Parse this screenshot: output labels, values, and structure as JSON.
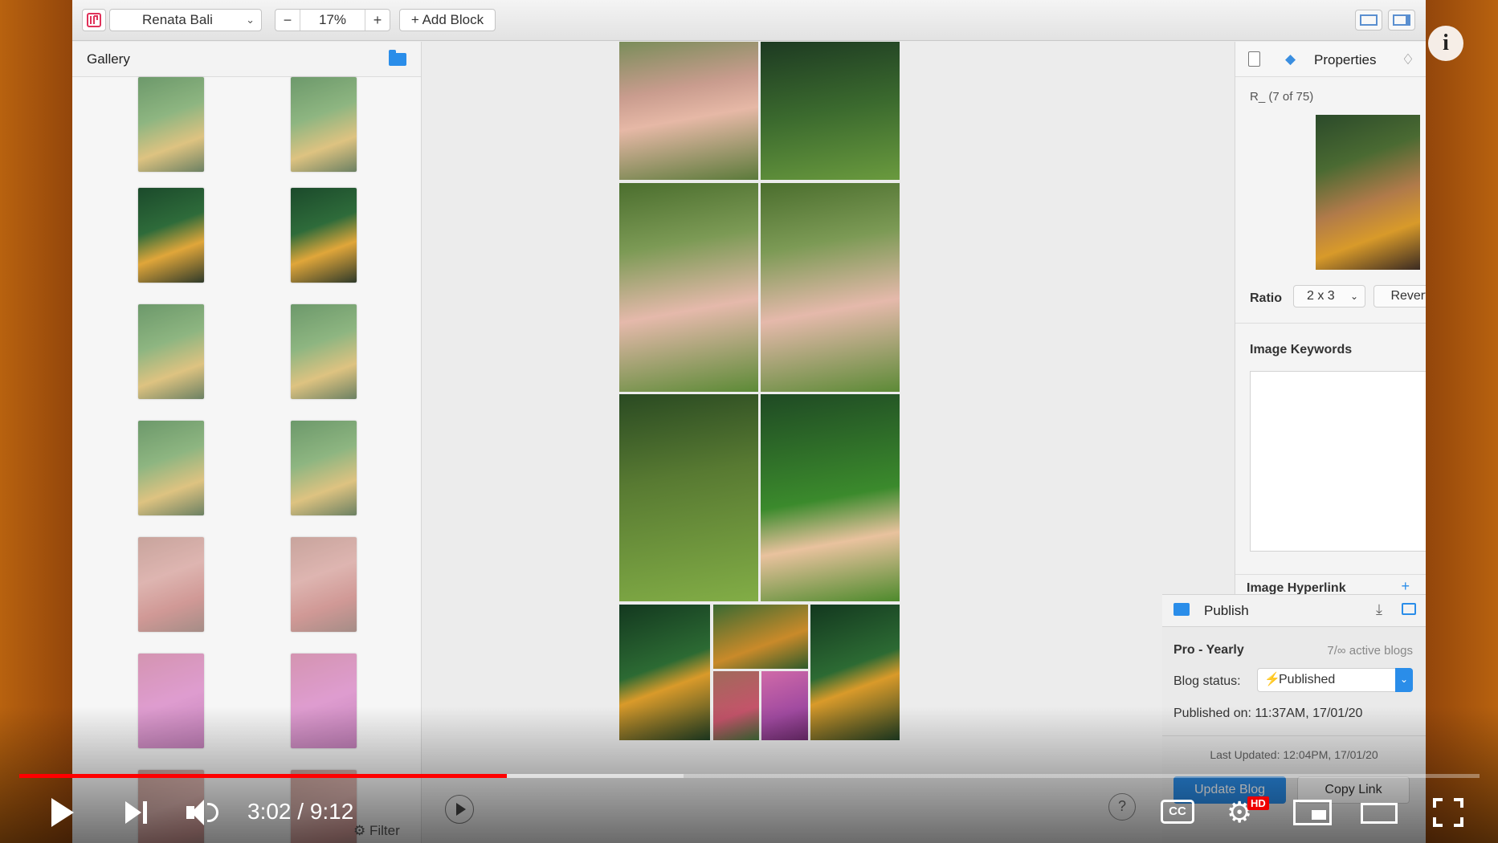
{
  "toolbar": {
    "blog_name": "Renata Bali",
    "zoom": "17%",
    "zoom_minus": "−",
    "zoom_plus": "+",
    "add_block": "+ Add Block"
  },
  "gallery": {
    "title": "Gallery"
  },
  "properties": {
    "title": "Properties",
    "image_count": "R_ (7 of 75)",
    "ratio_label": "Ratio",
    "ratio_value": "2 x 3",
    "revert": "Revert",
    "keywords_label": "Image Keywords",
    "hyperlink_label": "Image Hyperlink",
    "hyperlink_add": "+"
  },
  "publish": {
    "title": "Publish",
    "plan": "Pro - Yearly",
    "active_blogs": "7/∞ active blogs",
    "status_label": "Blog status:",
    "status_value": "Published",
    "published_on": "Published on:  11:37AM, 17/01/20",
    "last_updated": "Last Updated: 12:04PM, 17/01/20",
    "update_blog": "Update Blog",
    "copy_link": "Copy Link"
  },
  "bottom": {
    "filter": "⚙ Filter",
    "help": "?"
  },
  "video": {
    "time": "3:02 / 9:12",
    "played_percent": 33.4,
    "buffered_percent": 45.5,
    "cc": "CC",
    "hd": "HD",
    "info": "i"
  }
}
